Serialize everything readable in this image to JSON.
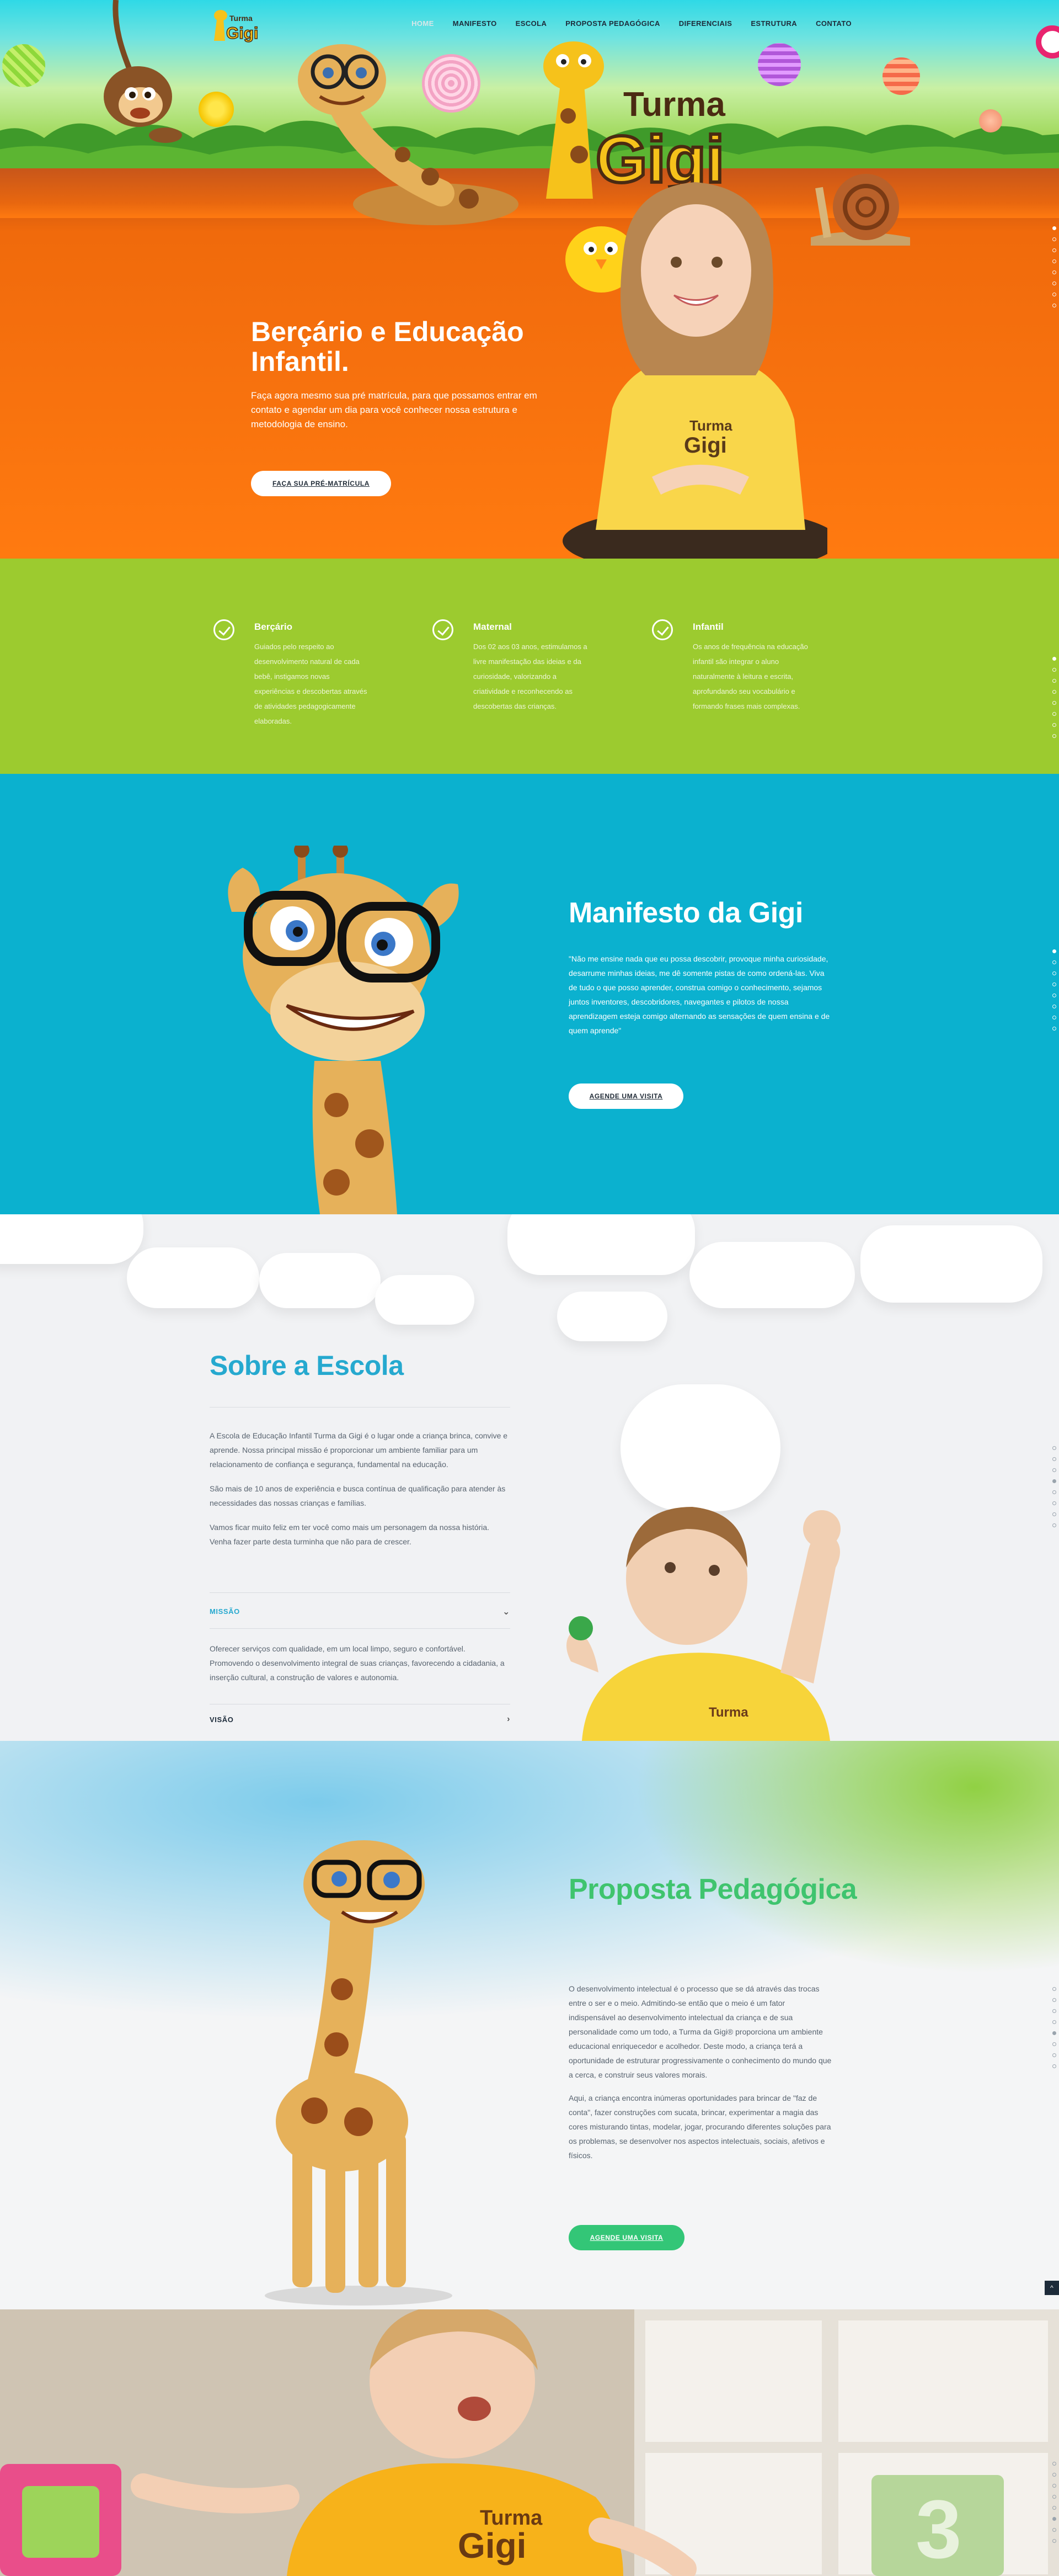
{
  "nav": {
    "items": [
      {
        "label": "HOME",
        "active": true
      },
      {
        "label": "MANIFESTO"
      },
      {
        "label": "ESCOLA"
      },
      {
        "label": "PROPOSTA PEDAGÓGICA"
      },
      {
        "label": "DIFERENCIAIS"
      },
      {
        "label": "ESTRUTURA"
      },
      {
        "label": "CONTATO"
      }
    ]
  },
  "brand": {
    "logo_text_top": "Turma",
    "logo_text_bottom": "Gigi",
    "hero_logo_top": "Turma",
    "hero_logo_bottom": "Gigi",
    "shirt_text_top": "Turma",
    "shirt_text_bottom": "Gigi"
  },
  "hero": {
    "title": "Berçário e Educação Infantil.",
    "text": "Faça agora mesmo sua pré matrícula, para que possamos entrar em contato e agendar um dia para você conhecer nossa estrutura e metodologia de ensino.",
    "button": "FAÇA SUA PRÉ-MATRÍCULA"
  },
  "features": [
    {
      "title": "Berçário",
      "text": "Guiados pelo respeito ao desenvolvimento natural de cada bebê, instigamos novas experiências e descobertas através de atividades pedagogicamente elaboradas."
    },
    {
      "title": "Maternal",
      "text": "Dos 02 aos 03 anos, estimulamos a livre manifestação das ideias e da curiosidade, valorizando a criatividade e reconhecendo as descobertas das crianças."
    },
    {
      "title": "Infantil",
      "text": "Os anos de frequência na educação infantil são integrar o aluno naturalmente à leitura e escrita, aprofundando seu vocabulário e formando frases mais complexas."
    }
  ],
  "manifesto": {
    "title": "Manifesto da Gigi",
    "text": "\"Não me ensine nada que eu possa descobrir, provoque minha curiosidade, desarrume minhas ideias, me dê somente pistas de como ordená-las. Viva de tudo o que posso aprender, construa comigo o conhecimento, sejamos juntos inventores, descobridores, navegantes e pilotos de nossa aprendizagem esteja comigo alternando as sensações de quem ensina e de quem aprende\"",
    "button": "AGENDE UMA VISITA"
  },
  "sobre": {
    "title": "Sobre a Escola",
    "paragraphs": [
      "A Escola de Educação Infantil Turma da Gigi é o lugar onde a criança brinca, convive e aprende. Nossa principal missão é proporcionar um ambiente familiar para um relacionamento de confiança e segurança, fundamental na educação.",
      "São mais de 10 anos de experiência e busca contínua de qualificação para atender às necessidades das nossas crianças e famílias.",
      "Vamos ficar muito feliz em ter você como mais um personagem da nossa história. Venha fazer parte desta turminha que não para de crescer."
    ],
    "accordion": [
      {
        "label": "MISSÃO",
        "open": true,
        "chevron": "⌄",
        "text": "Oferecer serviços com qualidade, em um local limpo, seguro e confortável. Promovendo o desenvolvimento integral de suas crianças, favorecendo a cidadania, a inserção cultural, a construção de valores e autonomia."
      },
      {
        "label": "VISÃO",
        "open": false,
        "chevron": "›"
      }
    ]
  },
  "proposta": {
    "title": "Proposta Pedagógica",
    "paragraphs": [
      "O desenvolvimento intelectual é o processo que se dá através das trocas entre o ser e o meio. Admitindo-se então que o meio é um fator indispensável ao desenvolvimento intelectual da criança e de sua personalidade como um todo, a Turma da Gigi® proporciona um ambiente educacional enriquecedor e acolhedor. Deste modo, a criança terá a oportunidade de estruturar progressivamente o conhecimento do mundo que a cerca, e construir seus valores morais.",
      "Aqui, a criança encontra inúmeras oportunidades para brincar de \"faz de conta\", fazer construções com sucata, brincar, experimentar a magia das cores misturando tintas, modelar, jogar, procurando diferentes soluções para os problemas, se desenvolver nos aspectos intelectuais, sociais, afetivos e físicos."
    ],
    "button": "AGENDE UMA VISITA",
    "up_icon": "^"
  },
  "photo": {
    "shirt_text_top": "Turma",
    "shirt_text_bottom": "Gigi",
    "block_number": "3"
  },
  "colors": {
    "orange": "#ff7a10",
    "green": "#9ccb2f",
    "blue": "#0bb1cf",
    "title_blue": "#26a9cf",
    "title_green": "#3fc46e",
    "button_green": "#33c677"
  },
  "icons": [
    "check-circle-icon",
    "chevron-down-icon",
    "chevron-right-icon",
    "arrow-up-icon"
  ]
}
